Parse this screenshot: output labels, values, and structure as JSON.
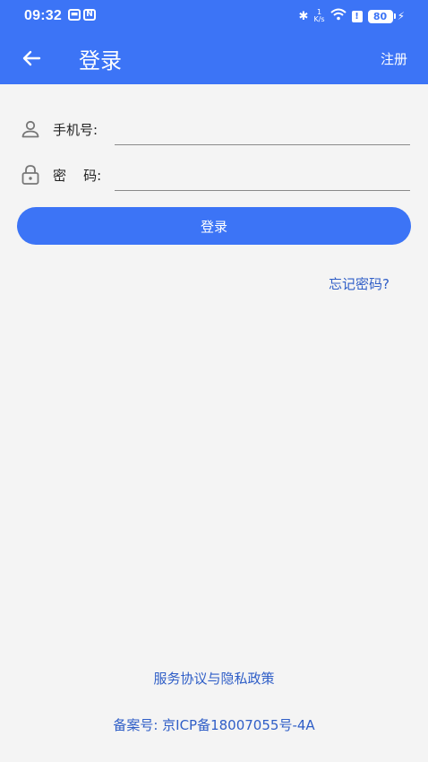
{
  "status_bar": {
    "time": "09:32",
    "left_icons": [
      "message-icon",
      "nfc-icon"
    ],
    "bluetooth_icon": "bluetooth-icon",
    "speed_value": "1",
    "speed_unit": "K/s",
    "wifi_icon": "wifi-icon",
    "alert_icon": "!",
    "battery": "80"
  },
  "header": {
    "title": "登录",
    "register_label": "注册",
    "back_icon": "back-arrow-icon"
  },
  "form": {
    "phone_label": "手机号:",
    "phone_value": "",
    "phone_icon": "user-icon",
    "password_label": "密    码:",
    "password_value": "",
    "password_icon": "lock-icon"
  },
  "actions": {
    "login_label": "登录",
    "forgot_label": "忘记密码?"
  },
  "footer": {
    "agreement_label": "服务协议与隐私政策",
    "icp": "备案号: 京ICP备18007055号-4A"
  },
  "colors": {
    "primary": "#3c74f6",
    "link": "#2f5ec7",
    "background": "#f4f4f4"
  }
}
